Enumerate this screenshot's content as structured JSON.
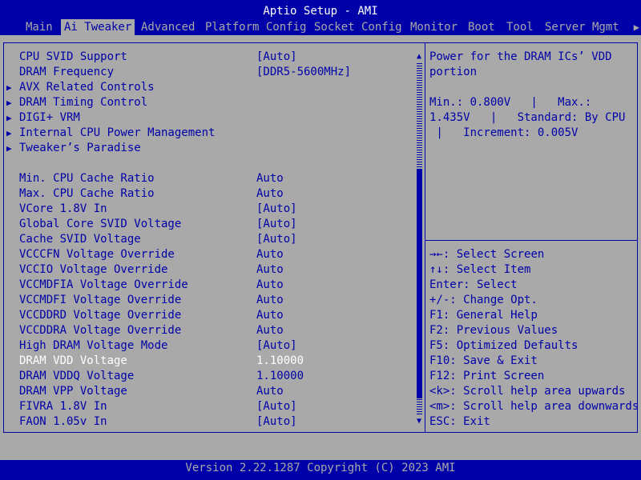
{
  "title": "Aptio Setup - AMI",
  "tabs": [
    {
      "label": "Main"
    },
    {
      "label": "Ai Tweaker"
    },
    {
      "label": "Advanced"
    },
    {
      "label": "Platform Config"
    },
    {
      "label": "Socket Config"
    },
    {
      "label": "Monitor"
    },
    {
      "label": "Boot"
    },
    {
      "label": "Tool"
    },
    {
      "label": "Server Mgmt"
    }
  ],
  "tab_more_icon": "▶",
  "settings": [
    {
      "label": "CPU SVID Support",
      "value": "[Auto]"
    },
    {
      "label": "DRAM Frequency",
      "value": "[DDR5-5600MHz]"
    },
    {
      "label": "AVX Related Controls",
      "submenu_icon": "▶"
    },
    {
      "label": "DRAM Timing Control",
      "submenu_icon": "▶"
    },
    {
      "label": "DIGI+ VRM",
      "submenu_icon": "▶"
    },
    {
      "label": "Internal CPU Power Management",
      "submenu_icon": "▶"
    },
    {
      "label": "Tweaker’s Paradise",
      "submenu_icon": "▶"
    },
    {
      "label": "Min. CPU Cache Ratio",
      "value": "Auto"
    },
    {
      "label": "Max. CPU Cache Ratio",
      "value": "Auto"
    },
    {
      "label": "VCore 1.8V In",
      "value": "[Auto]"
    },
    {
      "label": "Global Core SVID Voltage",
      "value": "[Auto]"
    },
    {
      "label": "Cache SVID Voltage",
      "value": "[Auto]"
    },
    {
      "label": "VCCCFN Voltage Override",
      "value": "Auto"
    },
    {
      "label": "VCCIO Voltage Override",
      "value": "Auto"
    },
    {
      "label": "VCCMDFIA Voltage Override",
      "value": "Auto"
    },
    {
      "label": "VCCMDFI Voltage Override",
      "value": "Auto"
    },
    {
      "label": "VCCDDRD Voltage Override",
      "value": "Auto"
    },
    {
      "label": "VCCDDRA Voltage Override",
      "value": "Auto"
    },
    {
      "label": "High DRAM Voltage Mode",
      "value": "[Auto]"
    },
    {
      "label": "DRAM VDD Voltage",
      "value": "1.10000"
    },
    {
      "label": "DRAM VDDQ Voltage",
      "value": "1.10000"
    },
    {
      "label": "DRAM VPP Voltage",
      "value": "Auto"
    },
    {
      "label": "FIVRA 1.8V In",
      "value": "[Auto]"
    },
    {
      "label": "FAON 1.05v In",
      "value": "[Auto]"
    }
  ],
  "scroll": {
    "up_icon": "▲",
    "down_icon": "▼"
  },
  "help": {
    "lines": [
      "Power for the DRAM ICs’ VDD",
      "portion",
      "",
      "Min.: 0.800V   |   Max.:",
      "1.435V   |   Standard: By CPU",
      " |   Increment: 0.005V"
    ]
  },
  "keys": [
    {
      "key": "→←:",
      "desc": " Select Screen"
    },
    {
      "key": "↑↓:",
      "desc": " Select Item"
    },
    {
      "key": "Enter:",
      "desc": " Select"
    },
    {
      "key": "+/-:",
      "desc": " Change Opt."
    },
    {
      "key": "F1:",
      "desc": " General Help"
    },
    {
      "key": "F2:",
      "desc": " Previous Values"
    },
    {
      "key": "F5:",
      "desc": " Optimized Defaults"
    },
    {
      "key": "F10:",
      "desc": " Save & Exit"
    },
    {
      "key": "F12:",
      "desc": " Print Screen"
    },
    {
      "key": "<k>:",
      "desc": " Scroll help area upwards"
    },
    {
      "key": "<m>:",
      "desc": " Scroll help area downwards"
    },
    {
      "key": "ESC:",
      "desc": " Exit"
    }
  ],
  "footer": "Version 2.22.1287 Copyright (C) 2023 AMI"
}
